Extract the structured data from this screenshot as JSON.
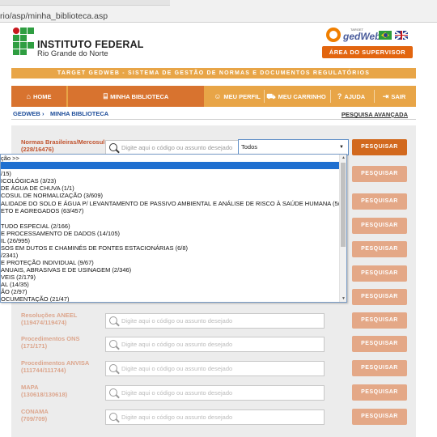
{
  "browser": {
    "url": "rio/asp/minha_biblioteca.asp"
  },
  "header": {
    "institute_title": "INSTITUTO FEDERAL",
    "institute_subtitle": "Rio Grande do Norte",
    "brand_name": "gedWeb",
    "brand_small": "TARGET",
    "supervisor_button": "ÁREA DO SUPERVISOR",
    "accent_color": "#e2650f"
  },
  "title_bar": "TARGET GEDWEB - SISTEMA DE GESTÃO DE NORMAS E DOCUMENTOS REGULATÓRIOS",
  "nav": {
    "home": "HOME",
    "library": "MINHA BIBLIOTECA",
    "profile": "MEU PERFIL",
    "cart": "MEU CARRINHO",
    "help": "AJUDA",
    "exit": "SAIR"
  },
  "breadcrumb": {
    "root": "GEDWEB",
    "current": "MINHA BIBLIOTECA",
    "advanced_search": "PESQUISA AVANÇADA"
  },
  "search_placeholder": "Digite aqui o código ou assunto desejado",
  "search_button": "PESQUISAR",
  "first_row": {
    "label": "Normas Brasileiras/Mercosul",
    "count": "(228/16476)",
    "select_value": "Todos"
  },
  "dropdown": {
    "options": [
      "ção >>",
      "",
      "/15)",
      "ICOLÓGICAS (3/23)",
      " DE ÁGUA DE CHUVA (1/1)",
      "COSUL DE NORMALIZAÇÃO (3/609)",
      "ALIDADE DO SOLO E ÁGUA P/ LEVANTAMENTO DE PASSIVO AMBIENTAL E ANÁLISE DE RISCO À SAÚDE HUMANA (5/12)",
      "ETO E AGREGADOS (63/457)",
      "",
      "TUDO ESPECIAL (2/166)",
      "E PROCESSAMENTO DE DADOS (14/105)",
      "IL (26/995)",
      "SOS EM DUTOS E CHAMINÉS DE FONTES ESTACIONÁRIAS (6/8)",
      "/2341)",
      "E PROTEÇÃO INDIVIDUAL (9/67)",
      "ANUAIS, ABRASIVAS E DE USINAGEM (2/346)",
      "VEIS (2/179)",
      "AL (14/35)",
      "ÃO (2/97)",
      "OCUMENTAÇÃO (21/47)"
    ]
  },
  "rows": [
    {
      "label": "Resoluções ANEEL",
      "count": "(119474/119474)"
    },
    {
      "label": "Procedimentos ONS",
      "count": "(171/171)"
    },
    {
      "label": "Procedimentos ANVISA",
      "count": "(111744/111744)"
    },
    {
      "label": "MAPA",
      "count": "(130618/130618)"
    },
    {
      "label": "CONAMA",
      "count": "(709/709)"
    }
  ]
}
